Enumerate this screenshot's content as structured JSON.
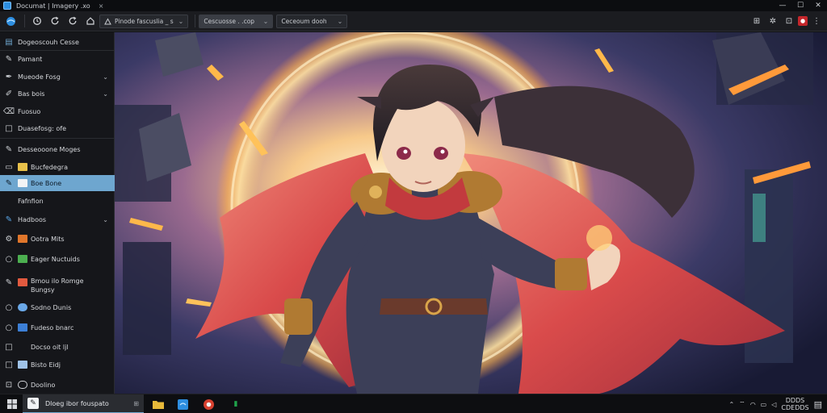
{
  "titlebar": {
    "title": "Documat | Imagery .xo",
    "close_tab": "×",
    "minimize": "—",
    "maximize": "☐",
    "close": "✕"
  },
  "toolbar": {
    "zoom_field": "Pinode fascuslia _ s",
    "layer_field": "Cescuosse . .cop",
    "blend_field": "Ceceoum dooh"
  },
  "sidebar": {
    "header": "Dogeoscouh Cesse",
    "items": [
      {
        "label": "Pamant",
        "icon": "brush-icon"
      },
      {
        "label": "Mueode Fosg",
        "icon": "pen-icon",
        "chevron": true
      },
      {
        "label": "Bas bois",
        "icon": "pencil-icon",
        "chevron": true
      },
      {
        "label": "Fuosuo",
        "icon": "eraser-icon"
      },
      {
        "label": "Duasefosg: ofe",
        "icon": "square-icon"
      },
      {
        "label": "Desseooone Moges",
        "icon": "brush-icon"
      },
      {
        "label": "Bucfedegra",
        "icon": "image-icon",
        "sub": "#e8c14a"
      },
      {
        "label": "Boe Bone",
        "icon": "brush-icon",
        "sub": "#f1f3f5",
        "selected": true
      },
      {
        "label": "Fafnfion",
        "icon": ""
      },
      {
        "label": "Hadboos",
        "icon": "brush-icon",
        "chevron": true
      },
      {
        "label": "Ootra Mits",
        "icon": "gear-icon",
        "sub": "#e0762b"
      },
      {
        "label": "Eager Nuctuids",
        "icon": "circle-icon",
        "sub": "#4caf50"
      },
      {
        "label": "Bmou ilo Romge Bungsy",
        "icon": "brush-icon",
        "sub": "#e25a3f"
      },
      {
        "label": "Sodno Dunis",
        "icon": "circle-icon",
        "sub": "#6aa8e8"
      },
      {
        "label": "Fudeso bnarc",
        "icon": "circle-icon",
        "sub": "#3c7fd6"
      },
      {
        "label": "Docso oit ljl",
        "icon": "square-icon"
      },
      {
        "label": "Bisto Eidj",
        "icon": "square-icon",
        "sub": "#9fc3e8"
      },
      {
        "label": "Doolino",
        "icon": "square-icon",
        "sub": "#d0d2d6"
      }
    ]
  },
  "taskbar": {
    "app_label": "Dloeg ibor fouspato",
    "clock_time": "DDDS",
    "clock_date": "CDEDDS"
  },
  "colors": {
    "accent": "#6ea6cf",
    "sidebar_bg": "#15161a",
    "toolbar_bg": "#1b1c20",
    "cape": "#d94b4b",
    "glow": "#ffd27a"
  }
}
